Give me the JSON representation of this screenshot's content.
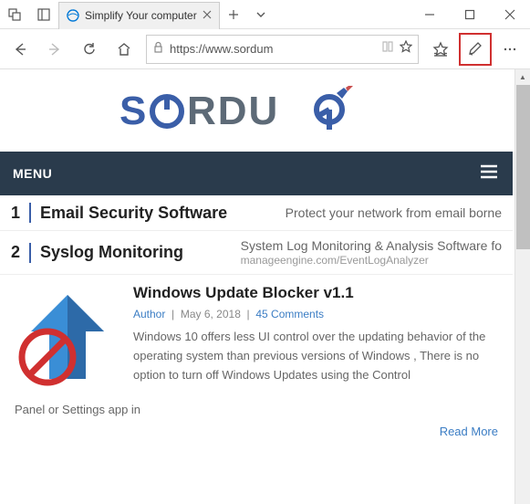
{
  "titlebar": {
    "tab_title": "Simplify Your computer"
  },
  "toolbar": {
    "url": "https://www.sordum"
  },
  "menu": {
    "label": "MENU"
  },
  "ads": [
    {
      "num": "1",
      "title": "Email Security Software",
      "desc": "Protect your network from email borne"
    },
    {
      "num": "2",
      "title": "Syslog Monitoring",
      "desc": "System Log Monitoring & Analysis Software fo",
      "sub": "manageengine.com/EventLogAnalyzer"
    }
  ],
  "article": {
    "title": "Windows Update Blocker v1.1",
    "author": "Author",
    "date": "May 6, 2018",
    "comments": "45 Comments",
    "text": "Windows 10 offers less UI control over the updating behavior of the operating system than previous versions of Windows , There is no option to turn off Windows Updates using the Control",
    "extra": "Panel or Settings app in",
    "readmore": "Read More"
  }
}
